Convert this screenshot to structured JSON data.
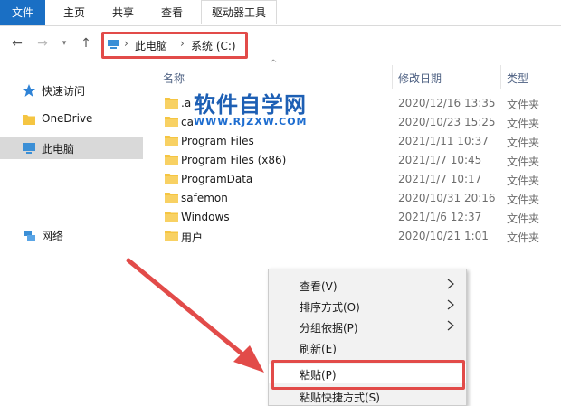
{
  "ribbon": {
    "tabs": [
      "文件",
      "主页",
      "共享",
      "查看",
      "驱动器工具"
    ]
  },
  "nav": {
    "back": "←",
    "forward": "→",
    "dropdown": "▾",
    "up": "↑"
  },
  "address": {
    "crumbs": [
      "此电脑",
      "系统 (C:)"
    ]
  },
  "sidebar": {
    "items": [
      "快速访问",
      "OneDrive",
      "此电脑",
      "网络"
    ]
  },
  "columns": {
    "name": "名称",
    "date": "修改日期",
    "type": "类型"
  },
  "files": [
    {
      "name": ".a",
      "date": "2020/12/16 13:35",
      "type": "文件夹"
    },
    {
      "name": "ca",
      "date": "2020/10/23 15:25",
      "type": "文件夹"
    },
    {
      "name": "Program Files",
      "date": "2021/1/11 10:37",
      "type": "文件夹"
    },
    {
      "name": "Program Files (x86)",
      "date": "2021/1/7 10:45",
      "type": "文件夹"
    },
    {
      "name": "ProgramData",
      "date": "2021/1/7 10:17",
      "type": "文件夹"
    },
    {
      "name": "safemon",
      "date": "2020/10/31 20:16",
      "type": "文件夹"
    },
    {
      "name": "Windows",
      "date": "2021/1/6 12:37",
      "type": "文件夹"
    },
    {
      "name": "用户",
      "date": "2020/10/21 1:01",
      "type": "文件夹"
    }
  ],
  "watermark": {
    "title": "软件自学网",
    "url": "WWW.RJZXW.COM"
  },
  "context_menu": {
    "items": [
      "查看(V)",
      "排序方式(O)",
      "分组依据(P)",
      "刷新(E)",
      "粘贴(P)",
      "粘贴快捷方式(S)"
    ]
  },
  "colors": {
    "highlight": "#e24b49",
    "accent": "#1a6fc4",
    "folder": "#f5c542"
  }
}
